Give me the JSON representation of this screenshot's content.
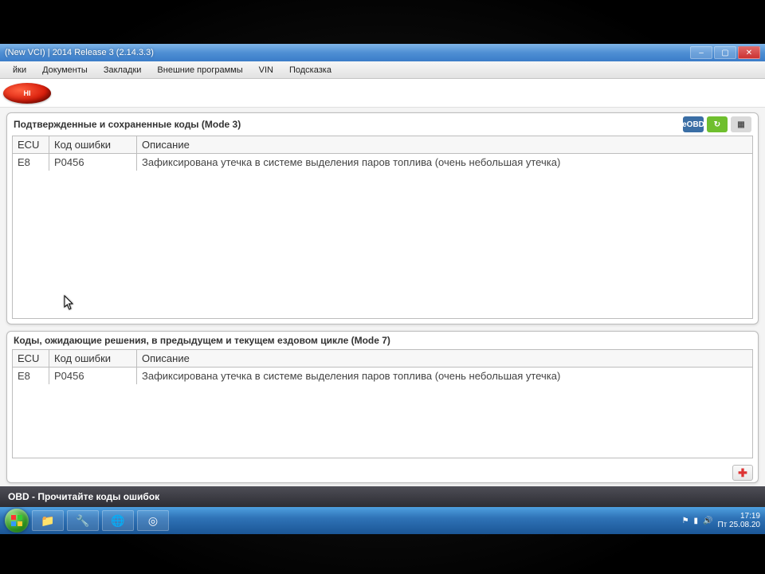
{
  "window": {
    "title": "(New VCI) | 2014 Release 3 (2.14.3.3)"
  },
  "menu": {
    "items": [
      "йки",
      "Документы",
      "Закладки",
      "Внешние программы",
      "VIN",
      "Подсказка"
    ]
  },
  "logo": {
    "text": "HI"
  },
  "panels": {
    "confirmed": {
      "title": "Подтвержденные и сохраненные коды (Mode 3)",
      "icons": {
        "eobd": "eOBD"
      },
      "columns": {
        "ecu": "ECU",
        "code": "Код ошибки",
        "desc": "Описание"
      },
      "rows": [
        {
          "ecu": "E8",
          "code": "P0456",
          "desc": "Зафиксирована утечка в системе выделения паров топлива (очень небольшая утечка)"
        }
      ]
    },
    "pending": {
      "title": "Коды, ожидающие решения, в предыдущем и текущем ездовом цикле (Mode 7)",
      "columns": {
        "ecu": "ECU",
        "code": "Код ошибки",
        "desc": "Описание"
      },
      "rows": [
        {
          "ecu": "E8",
          "code": "P0456",
          "desc": "Зафиксирована утечка в системе выделения паров топлива (очень небольшая утечка)"
        }
      ]
    }
  },
  "status": {
    "text": "OBD - Прочитайте коды ошибок"
  },
  "taskbar": {
    "time": "17:19",
    "date": "Пт 25.08.20"
  }
}
